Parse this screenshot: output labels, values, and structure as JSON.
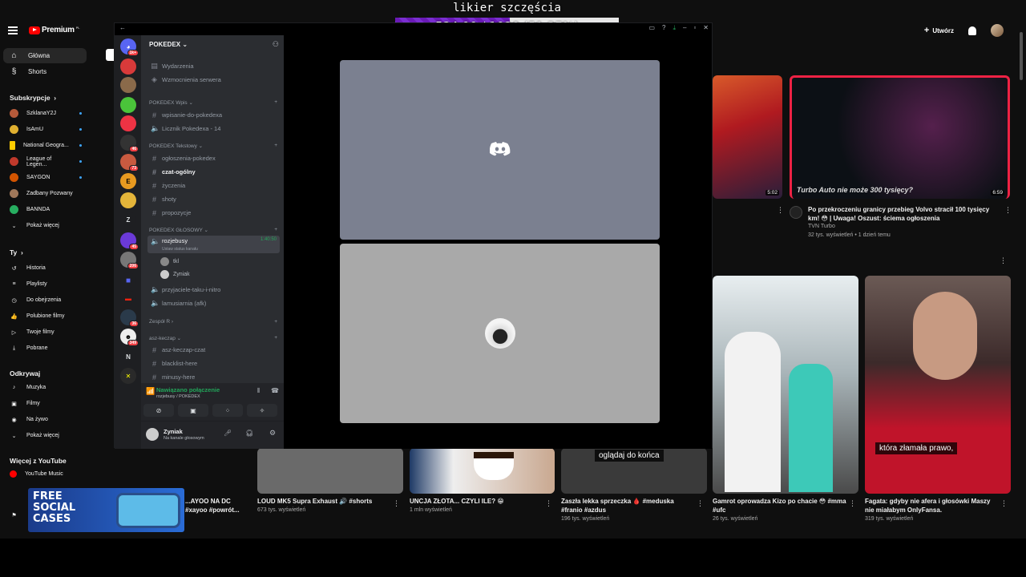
{
  "overlay": {
    "title": "likier szczęścia",
    "progress_text": "524.00 / 1020 (51.37%)",
    "progress_fraction": 0.5137
  },
  "youtube": {
    "logo": "Premium",
    "logo_region": "PL",
    "create_label": "Utwórz",
    "nav": [
      {
        "label": "Główna",
        "icon": "home-icon"
      },
      {
        "label": "Shorts",
        "icon": "shorts-icon"
      }
    ],
    "subs_heading": "Subskrypcje",
    "subscriptions": [
      {
        "label": "SzklanaY2J",
        "color": "#b55a3a"
      },
      {
        "label": "IsAmU",
        "color": "#e0b030"
      },
      {
        "label": "National Geogra...",
        "color": "#ffcc00"
      },
      {
        "label": "League of Legen...",
        "color": "#c0392b"
      },
      {
        "label": "SAYGON",
        "color": "#d35400"
      },
      {
        "label": "Zadbany Pozwany",
        "color": "#a0785a"
      },
      {
        "label": "BANNDA",
        "color": "#27ae60"
      }
    ],
    "show_more": "Pokaż więcej",
    "you_heading": "Ty",
    "you_items": [
      {
        "label": "Historia",
        "icon": "history-icon"
      },
      {
        "label": "Playlisty",
        "icon": "playlist-icon"
      },
      {
        "label": "Do obejrzenia",
        "icon": "clock-icon"
      },
      {
        "label": "Polubione filmy",
        "icon": "thumbs-up-icon"
      },
      {
        "label": "Twoje filmy",
        "icon": "video-icon"
      },
      {
        "label": "Pobrane",
        "icon": "download-icon"
      }
    ],
    "explore_heading": "Odkrywaj",
    "explore_items": [
      {
        "label": "Muzyka",
        "icon": "music-icon"
      },
      {
        "label": "Filmy",
        "icon": "film-icon"
      },
      {
        "label": "Na żywo",
        "icon": "live-icon"
      },
      {
        "label": "Pokaż więcej",
        "icon": "chevron-down-icon"
      }
    ],
    "more_heading": "Więcej z YouTube",
    "more_items": [
      {
        "label": "YouTube Music",
        "icon": "youtube-music-icon"
      }
    ],
    "promo_text": "FREE SOCIAL CASES",
    "videos": [
      {
        "title": "Po przekroczeniu granicy przebieg Volvo stracił 100 tysięcy km! 😳 | Uwaga! Oszust: ściema ogłoszenia",
        "channel": "TVN Turbo",
        "meta": "32 tys. wyświetleń • 1 dzień temu",
        "duration": "6:59",
        "thumb_caption": "Turbo Auto nie może 300 tysięcy?"
      },
      {
        "title": "",
        "duration": "5:02"
      },
      {
        "title": "...AYOO NA DC #xayoo #powrót...",
        "meta": ""
      },
      {
        "title": "LOUD MK5 Supra Exhaust 🔊 #shorts",
        "meta": "673 tys. wyświetleń"
      },
      {
        "title": "UNCJA ZŁOTA... CZYLI ILE? 😁",
        "meta": "1 mln wyświetleń"
      },
      {
        "title": "Zaszła lekka sprzeczka 🩸 #meduska #franio #azdus",
        "meta": "196 tys. wyświetleń",
        "caption": "oglądaj do końca"
      },
      {
        "title": "Gamrot oprowadza Kizo po chacie 😳 #mma #ufc",
        "meta": "26 tys. wyświetleń"
      },
      {
        "title": "Fagata: gdyby nie afera i głosówki Maszy nie miałabym OnlyFansa.",
        "meta": "319 tys. wyświetleń",
        "caption": "która złamała prawo,"
      }
    ]
  },
  "discord": {
    "server_name": "POKEDEX",
    "top_items": [
      "Wydarzenia",
      "Wzmocnienia serwera"
    ],
    "categories": [
      {
        "name": "POKEDEX Wpis",
        "channels": [
          "wpisanie-do-pokedexa",
          "Licznik Pokedexa - 14"
        ]
      },
      {
        "name": "POKEDEX Tekstowy",
        "channels": [
          "ogłoszenia-pokedex",
          "czat-ogólny",
          "życzenia",
          "shoty",
          "propozycje"
        ]
      },
      {
        "name": "POKEDEX GŁOSOWY",
        "channels": [
          "rozjebusy",
          "przyjaciele-taku-i-nitro",
          "lamusiarnia (afk)"
        ]
      },
      {
        "name": "Zespół R",
        "channels": []
      },
      {
        "name": "asz-keczap",
        "channels": [
          "asz-keczap-czat",
          "blacklist-here",
          "minusy-here"
        ]
      }
    ],
    "voice_channel_timer": "1:40:50",
    "voice_channel_status": "Ustaw status kanału",
    "voice_users": [
      "tkl",
      "Zyniak"
    ],
    "voice_connection": {
      "status": "Nawiązano połączenie",
      "location": "rozjebusy / POKEDEX"
    },
    "user": {
      "name": "Zyniak",
      "status": "Na kanale głosowym"
    },
    "guild_badges": [
      "1k+",
      "46",
      "73",
      "45",
      "206",
      "36",
      "349"
    ],
    "guild_letters": [
      "Z",
      "N"
    ]
  }
}
